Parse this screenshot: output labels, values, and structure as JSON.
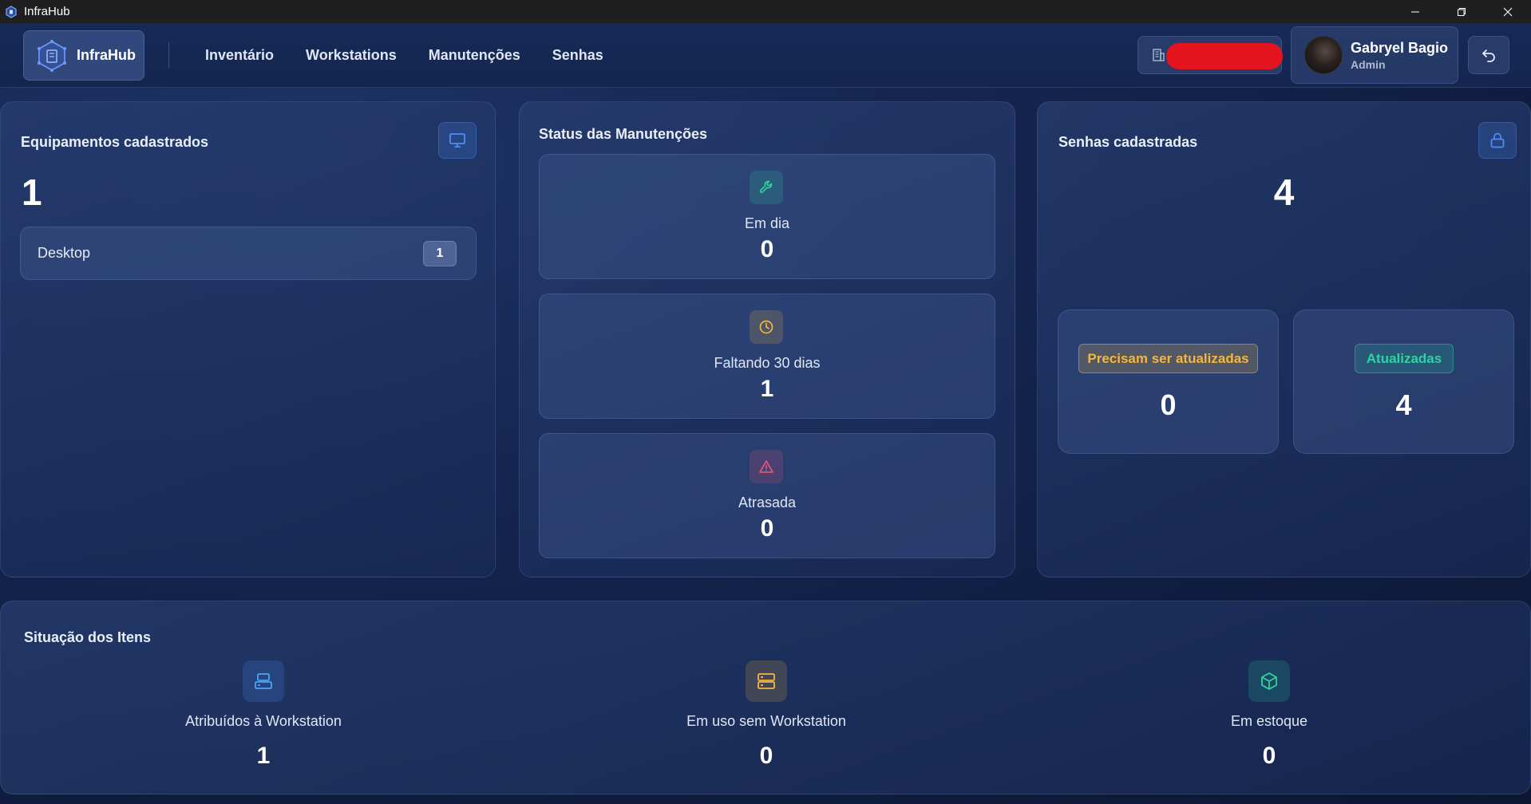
{
  "window": {
    "title": "InfraHub"
  },
  "navbar": {
    "brand": "InfraHub",
    "links": [
      "Inventário",
      "Workstations",
      "Manutenções",
      "Senhas"
    ],
    "user": {
      "name": "Gabryel Bagio",
      "role": "Admin"
    }
  },
  "equipamentos": {
    "title": "Equipamentos cadastrados",
    "total": "1",
    "items": [
      {
        "label": "Desktop",
        "count": "1"
      }
    ]
  },
  "manutencoes": {
    "title": "Status das Manutenções",
    "items": [
      {
        "label": "Em dia",
        "value": "0"
      },
      {
        "label": "Faltando 30 dias",
        "value": "1"
      },
      {
        "label": "Atrasada",
        "value": "0"
      }
    ]
  },
  "senhas": {
    "title": "Senhas cadastradas",
    "total": "4",
    "pending": {
      "label": "Precisam ser atualizadas",
      "value": "0"
    },
    "updated": {
      "label": "Atualizadas",
      "value": "4"
    }
  },
  "situacao": {
    "title": "Situação dos Itens",
    "items": [
      {
        "label": "Atribuídos à Workstation",
        "value": "1"
      },
      {
        "label": "Em uso sem Workstation",
        "value": "0"
      },
      {
        "label": "Em estoque",
        "value": "0"
      }
    ]
  },
  "colors": {
    "accent_blue": "#4d8cf5",
    "green": "#2fd3a0",
    "amber": "#f5b73b",
    "red": "#f0567a"
  }
}
